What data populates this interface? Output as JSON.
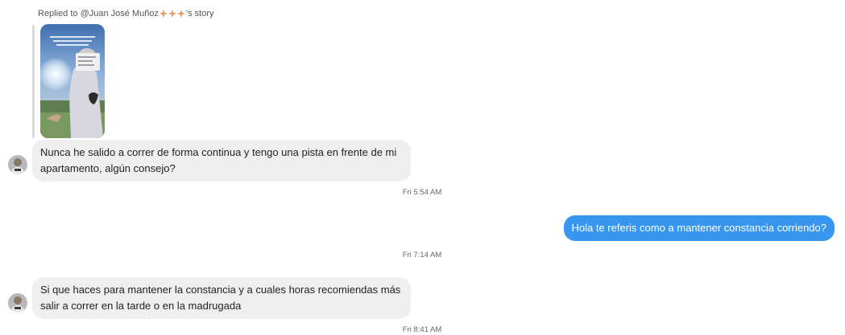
{
  "conversation": {
    "reply_caption": {
      "prefix": "Replied to @Juan José Muñoz",
      "suffix": "'s story",
      "emoji_icon": "sparkle-emoji-icon"
    },
    "messages": [
      {
        "direction": "incoming",
        "text": "Nunca he salido a correr de forma continua y tengo una pista en frente de mi apartamento, algún consejo?"
      },
      {
        "direction": "outgoing",
        "text": "Hola te referis como a mantener constancia corriendo?"
      },
      {
        "direction": "incoming",
        "text": "Si que haces para mantener la constancia y a cuales horas recomiendas más salir a correr en la tarde o en la madrugada"
      }
    ],
    "timestamps": [
      "Fri 5:54 AM",
      "Fri 7:14 AM",
      "Fri 8:41 AM"
    ]
  },
  "colors": {
    "incoming_bubble": "#efefef",
    "outgoing_bubble": "#3797f0",
    "emoji": "#e0672c"
  }
}
